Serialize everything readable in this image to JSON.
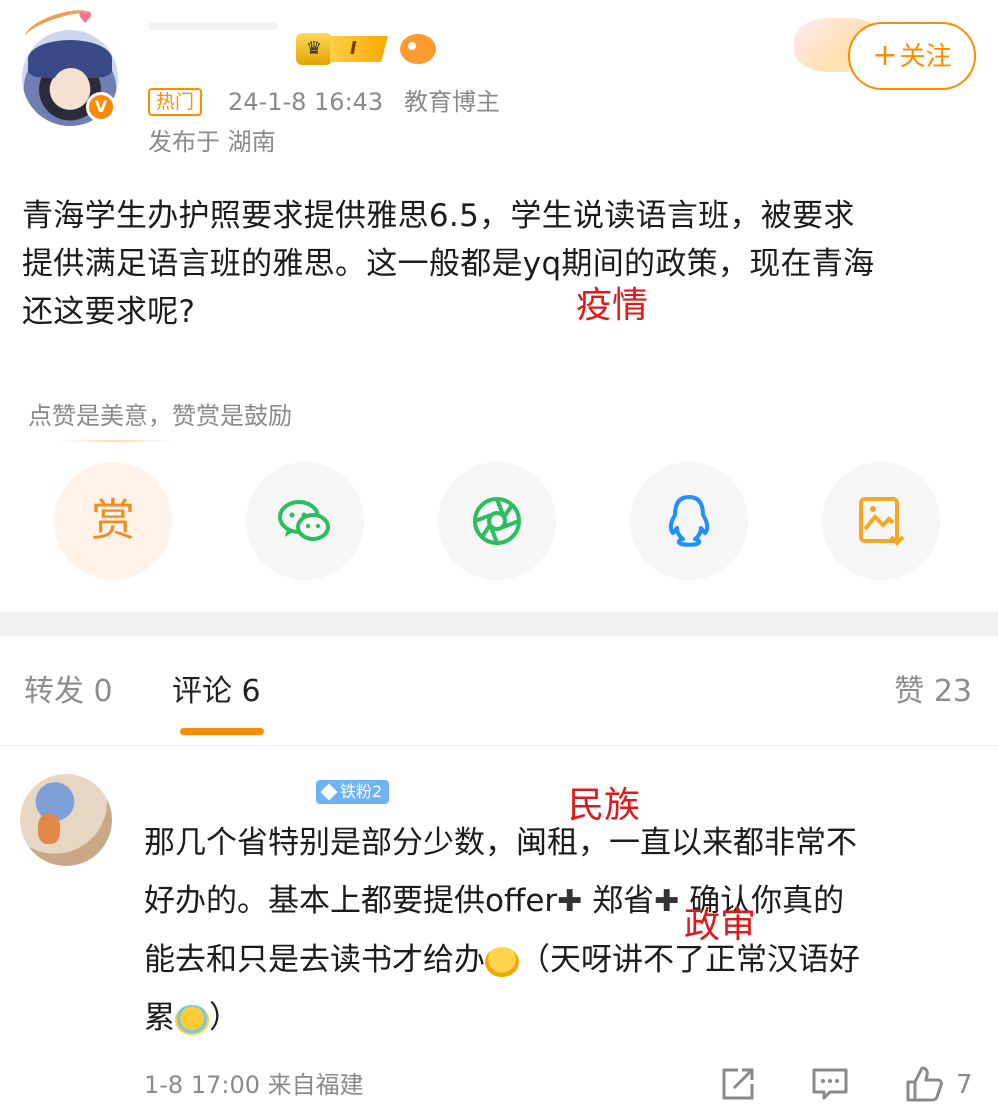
{
  "post": {
    "hot_tag": "热门",
    "time": "24-1-8 16:43",
    "role": "教育博主",
    "location": "发布于 湖南",
    "follow_label": "关注",
    "level_badge": "I",
    "body_line1": "青海学生办护照要求提供雅思6.5，学生说读语言班，被要求",
    "body_line2": "提供满足语言班的雅思。这一般都是yq期间的政策，现在青海",
    "body_line3": "还这要求呢?",
    "annotation": "疫情"
  },
  "reward": {
    "hint": "点赞是美意，赞赏是鼓励",
    "reward_label": "赏"
  },
  "share_buttons": [
    {
      "name": "reward",
      "icon": "reward-icon"
    },
    {
      "name": "wechat",
      "icon": "wechat-icon",
      "color": "#2bbd5e"
    },
    {
      "name": "moments",
      "icon": "moments-icon",
      "color": "#2bbd5e"
    },
    {
      "name": "qq",
      "icon": "qq-icon",
      "color": "#1e90ff"
    },
    {
      "name": "save-image",
      "icon": "save-image-icon",
      "color": "#f5a623"
    }
  ],
  "tabs": {
    "repost": "转发 0",
    "comments": "评论 6",
    "likes": "赞 23"
  },
  "comment": {
    "fan_badge": "铁粉2",
    "line1": "那几个省特别是部分少数，闽租，一直以来都非常不",
    "line2_a": "好办的。基本上都要提供offer",
    "line2_b": " 郑省",
    "line2_c": " 确认你真的",
    "line3": "能去和只是去读书才给办",
    "line3_b": "（天呀讲不了正常汉语好",
    "line4": "累",
    "line4_b": "）",
    "annotation_1": "民族",
    "annotation_2": "政审",
    "meta": "1-8 17:00  来自福建",
    "likes": "7"
  },
  "colors": {
    "accent": "#ff8c00",
    "annotation": "#e1171a"
  }
}
